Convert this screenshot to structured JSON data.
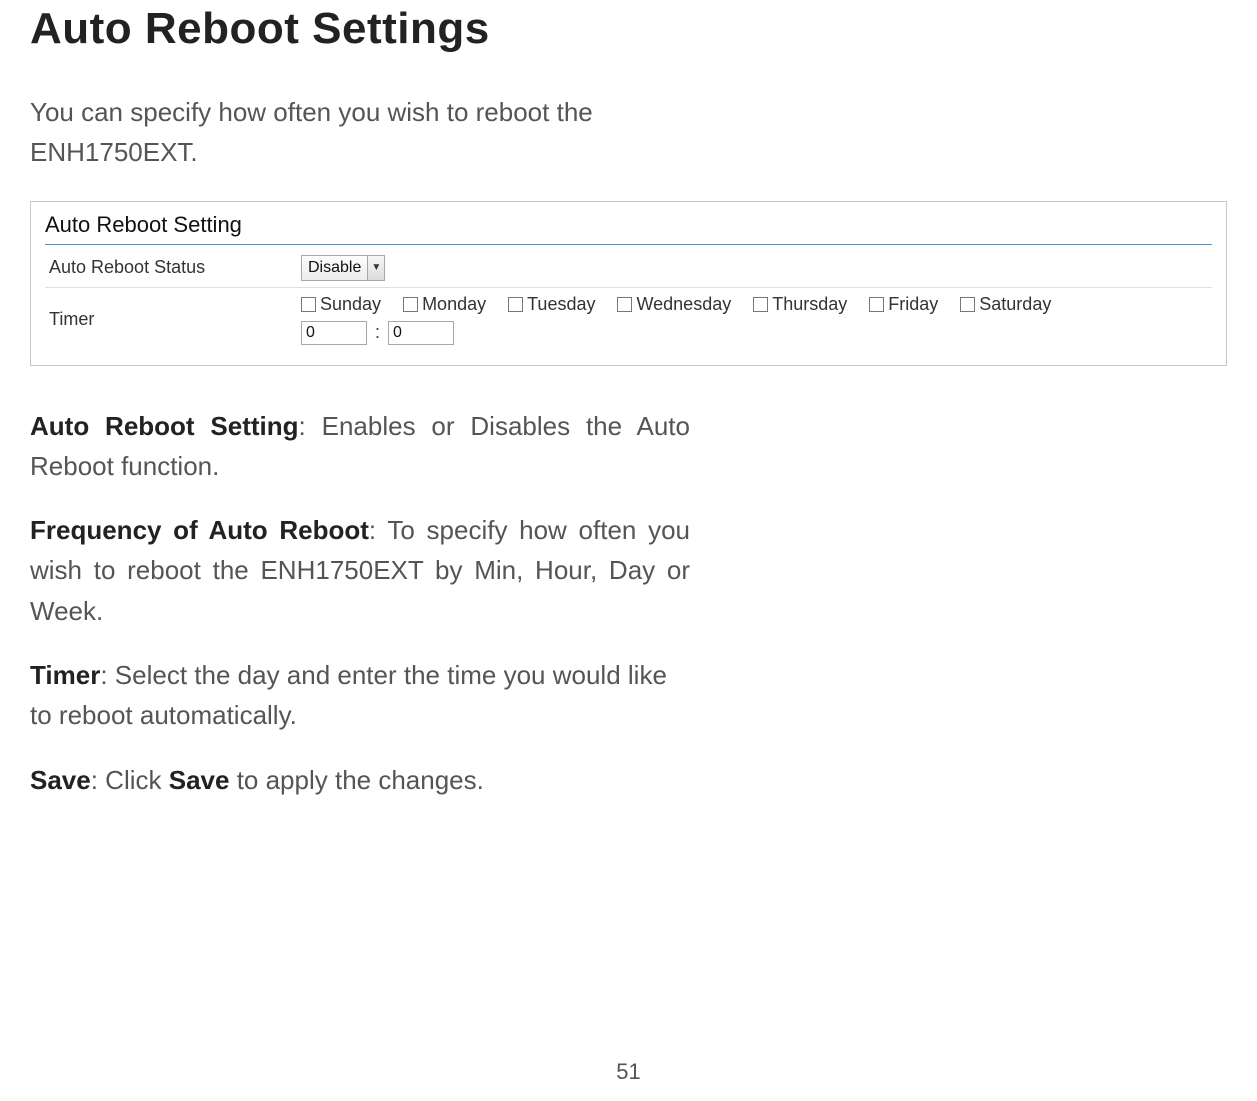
{
  "heading": "Auto Reboot Settings",
  "intro": "You can specify how often you wish to reboot the ENH1750EXT.",
  "panel": {
    "title": "Auto Reboot Setting",
    "status_label": "Auto Reboot Status",
    "status_value": "Disable",
    "timer_label": "Timer",
    "days": [
      {
        "name": "Sunday",
        "checked": false
      },
      {
        "name": "Monday",
        "checked": false
      },
      {
        "name": "Tuesday",
        "checked": false
      },
      {
        "name": "Wednesday",
        "checked": false
      },
      {
        "name": "Thursday",
        "checked": false
      },
      {
        "name": "Friday",
        "checked": false
      },
      {
        "name": "Saturday",
        "checked": false
      }
    ],
    "hour": "0",
    "colon": ":",
    "minute": "0"
  },
  "descriptions": {
    "d1_label": "Auto Reboot Setting",
    "d1_text": ": Enables or Disables the Auto Reboot function.",
    "d2_label": "Frequency of Auto Reboot",
    "d2_text": ": To specify how often you wish to reboot the ENH1750EXT by Min, Hour, Day or Week.",
    "d3_label": "Timer",
    "d3_text": ": Select the day and enter the time you would like to reboot automatically.",
    "d4_label": "Save",
    "d4_text_a": ": Click ",
    "d4_label2": "Save",
    "d4_text_b": " to apply the changes."
  },
  "page_number": "51"
}
